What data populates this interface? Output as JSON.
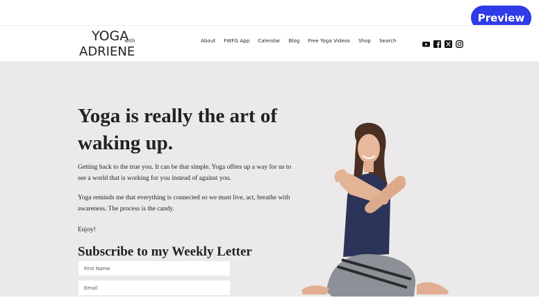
{
  "topbar": {
    "preview_label": "Preview"
  },
  "header": {
    "logo": {
      "line1": "YOGA",
      "with": "with",
      "line2": "ADRIENE"
    },
    "nav": [
      "About",
      "FWFG App",
      "Calendar",
      "Blog",
      "Free Yoga Videos",
      "Shop",
      "Search"
    ],
    "social_icons": [
      "youtube-icon",
      "facebook-icon",
      "x-icon",
      "instagram-icon"
    ]
  },
  "hero": {
    "headline": "Yoga is really the art of waking up.",
    "paragraph1": "Getting back to the true you. It can be that simple. Yoga offers up a way for us to see a world that is working for you instead of against you.",
    "paragraph2": "Yoga reminds me that everything is connected so we must live, act, breathe with awareness. The process is the candy.",
    "paragraph3": "Enjoy!",
    "subscribe_heading": "Subscribe to my Weekly Letter",
    "first_name_placeholder": "First Name",
    "email_placeholder": "Email"
  },
  "colors": {
    "accent": "#2f3be6",
    "hero_bg": "#ebe9ea",
    "text": "#222222"
  }
}
